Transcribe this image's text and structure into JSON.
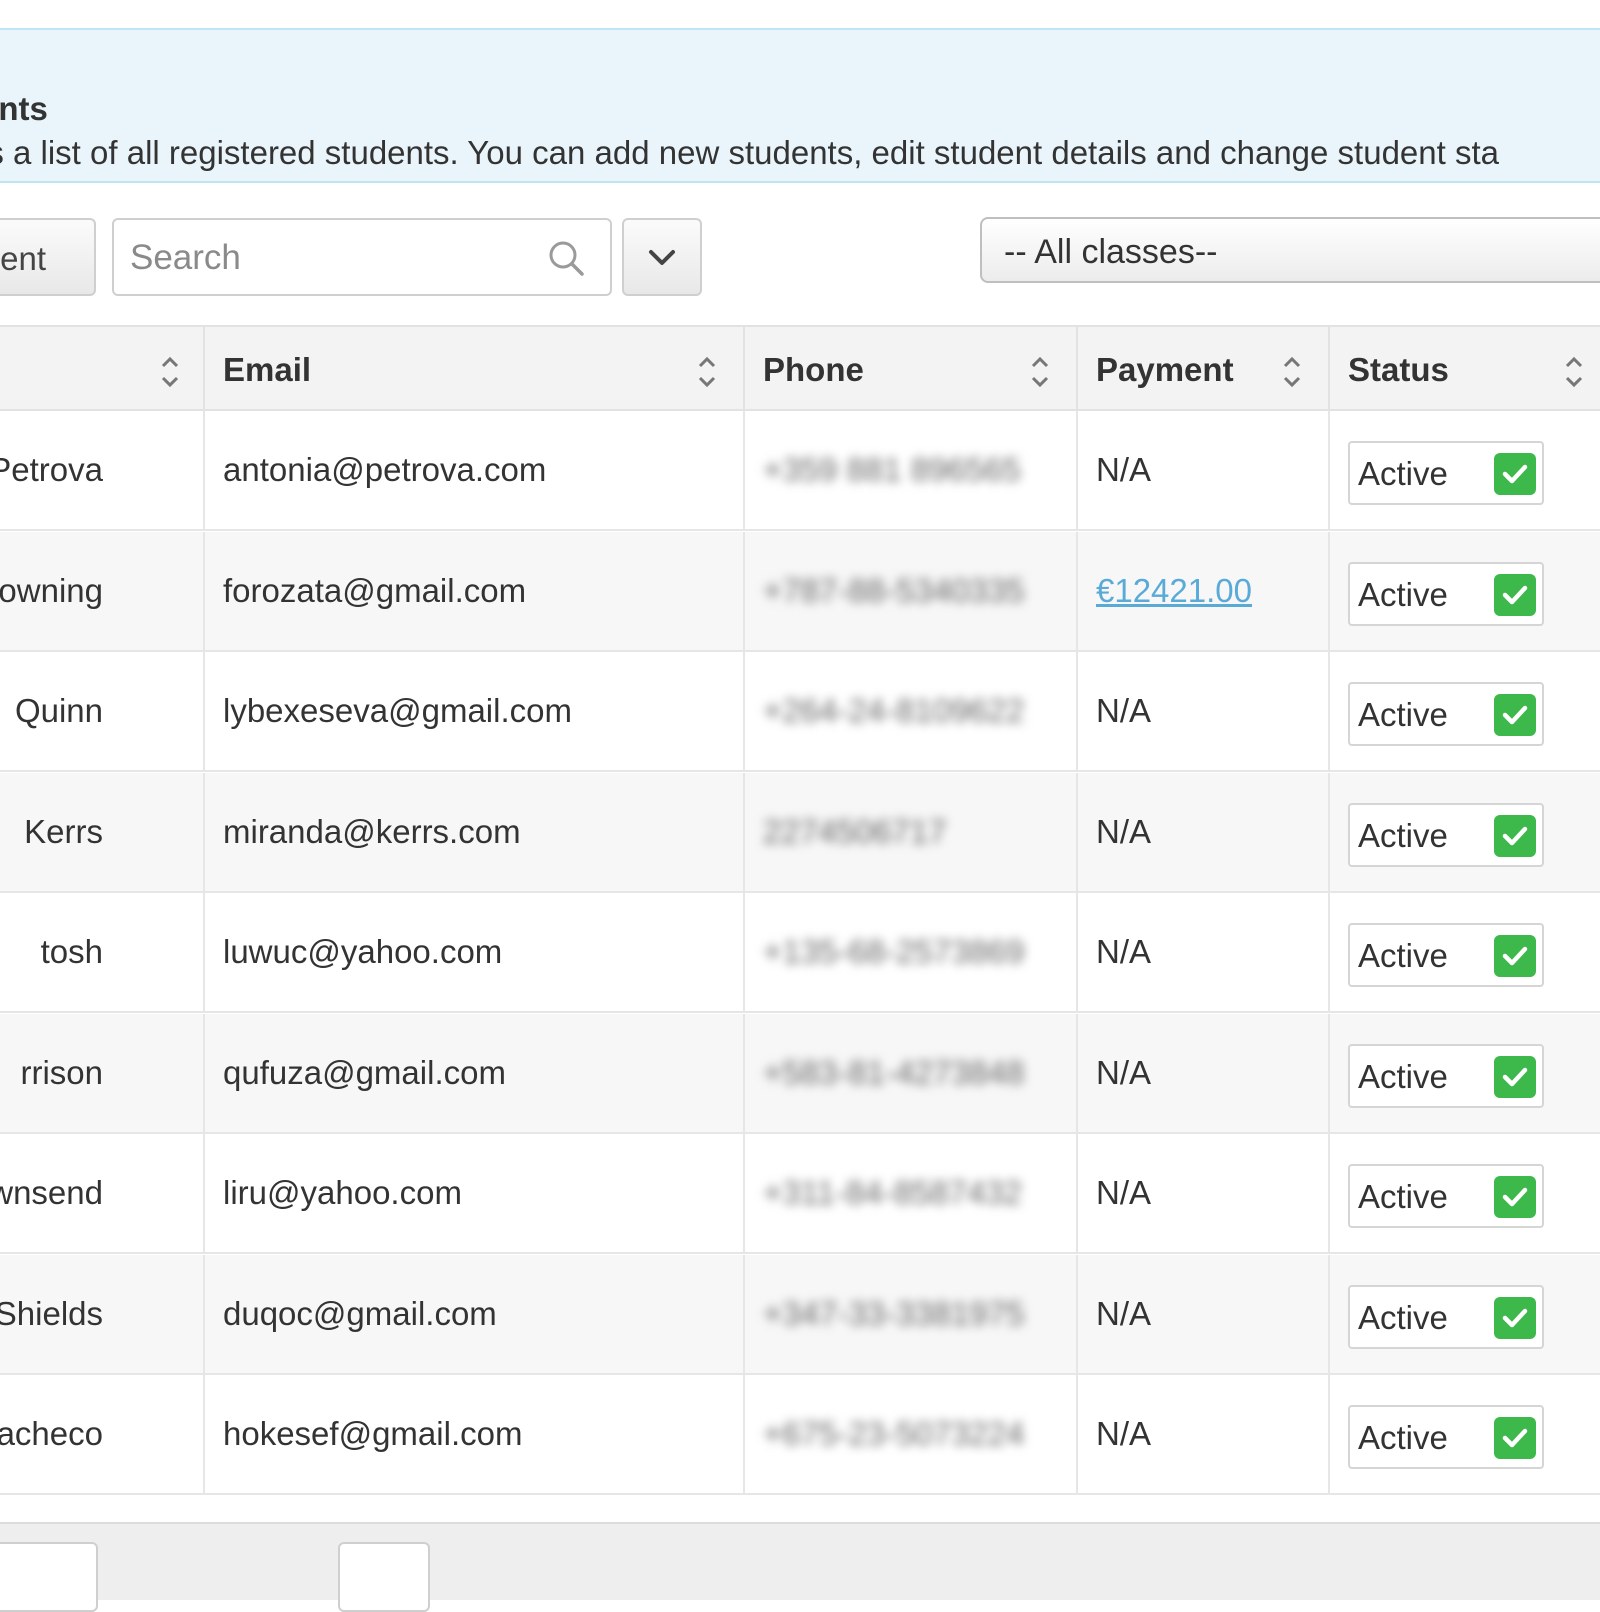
{
  "info": {
    "title": "ents",
    "description": "is a list of all registered students. You can add new students, edit student details and change student sta"
  },
  "toolbar": {
    "add_label": "ent",
    "search_placeholder": "Search",
    "class_filter": "-- All classes--"
  },
  "table": {
    "columns": [
      "",
      "Email",
      "Phone",
      "Payment",
      "Status"
    ],
    "rows": [
      {
        "name": "Petrova",
        "email": "antonia@petrova.com",
        "phone": "+359 881 896565",
        "payment": "N/A",
        "status": "Active"
      },
      {
        "name": "owning",
        "email": "forozata@gmail.com",
        "phone": "+787-88-5340335",
        "payment": "€12421.00",
        "status": "Active"
      },
      {
        "name": "Quinn",
        "email": "lybexeseva@gmail.com",
        "phone": "+264-24-8109622",
        "payment": "N/A",
        "status": "Active"
      },
      {
        "name": "Kerrs",
        "email": "miranda@kerrs.com",
        "phone": "2274506717",
        "payment": "N/A",
        "status": "Active"
      },
      {
        "name": "tosh",
        "email": "luwuc@yahoo.com",
        "phone": "+135-68-2573869",
        "payment": "N/A",
        "status": "Active"
      },
      {
        "name": "rrison",
        "email": "qufuza@gmail.com",
        "phone": "+583-81-4273848",
        "payment": "N/A",
        "status": "Active"
      },
      {
        "name": "ownsend",
        "email": "liru@yahoo.com",
        "phone": "+311-84-8587432",
        "payment": "N/A",
        "status": "Active"
      },
      {
        "name": "Shields",
        "email": "duqoc@gmail.com",
        "phone": "+347-33-3381975",
        "payment": "N/A",
        "status": "Active"
      },
      {
        "name": "Pacheco",
        "email": "hokesef@gmail.com",
        "phone": "+675-23-5073224",
        "payment": "N/A",
        "status": "Active"
      }
    ]
  },
  "colors": {
    "info_bg": "#e9f5fb",
    "link": "#5aaad8",
    "check": "#3cb94a"
  }
}
